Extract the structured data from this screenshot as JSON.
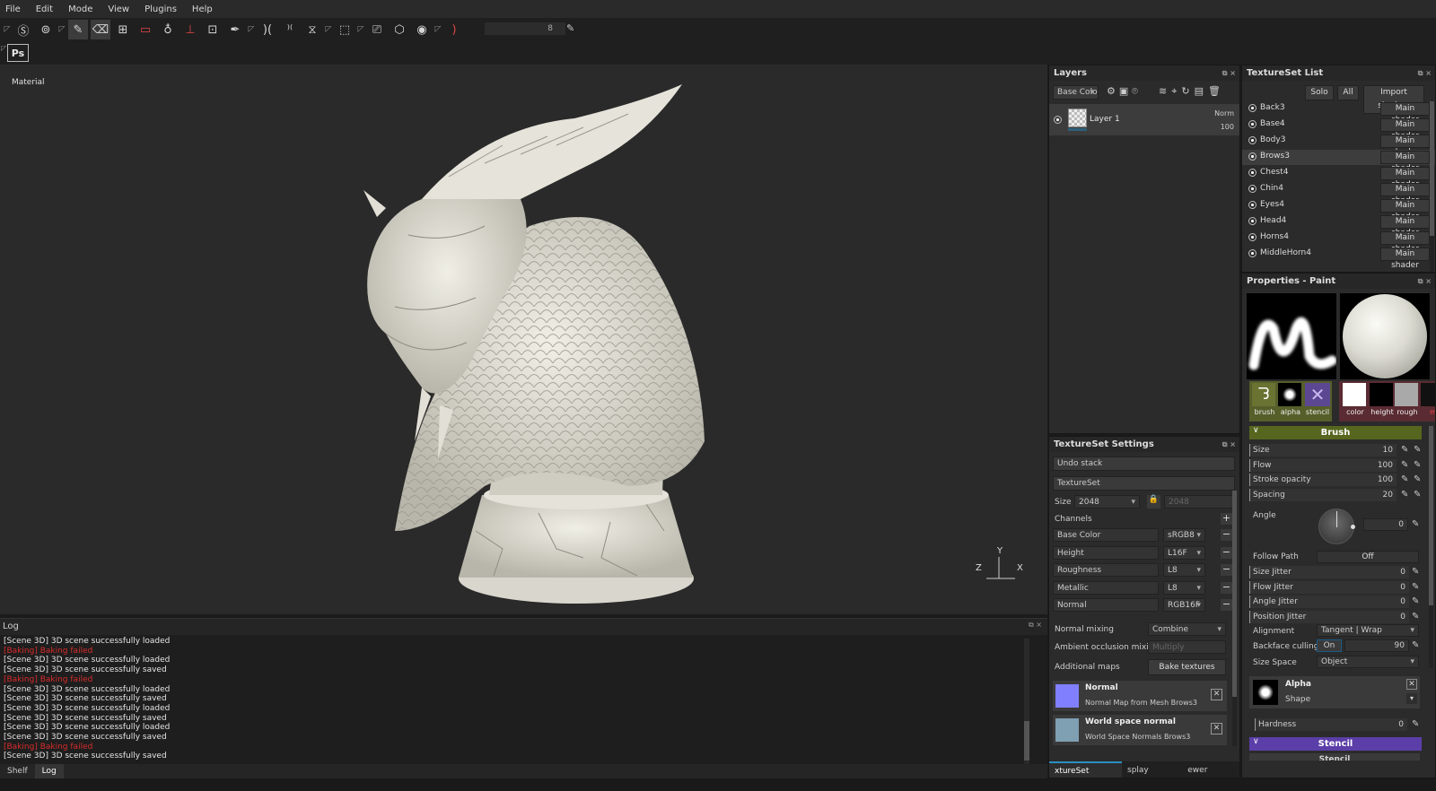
{
  "menu": [
    "File",
    "Edit",
    "Mode",
    "View",
    "Plugins",
    "Help"
  ],
  "toolbar": {
    "slider_value": "8",
    "ps_label": "Ps"
  },
  "viewport": {
    "label": "Material",
    "axis_y": "Y",
    "axis_z": "Z",
    "axis_x": "X"
  },
  "log": {
    "title": "Log",
    "lines": [
      {
        "t": "[Scene 3D] 3D scene successfully loaded",
        "err": false
      },
      {
        "t": "[Baking] Baking failed",
        "err": true
      },
      {
        "t": "[Scene 3D] 3D scene successfully loaded",
        "err": false
      },
      {
        "t": "[Scene 3D] 3D scene successfully saved",
        "err": false
      },
      {
        "t": "[Baking] Baking failed",
        "err": true
      },
      {
        "t": "[Scene 3D] 3D scene successfully loaded",
        "err": false
      },
      {
        "t": "[Scene 3D] 3D scene successfully saved",
        "err": false
      },
      {
        "t": "[Scene 3D] 3D scene successfully loaded",
        "err": false
      },
      {
        "t": "[Scene 3D] 3D scene successfully saved",
        "err": false
      },
      {
        "t": "[Scene 3D] 3D scene successfully loaded",
        "err": false
      },
      {
        "t": "[Scene 3D] 3D scene successfully saved",
        "err": false
      },
      {
        "t": "[Baking] Baking failed",
        "err": true
      },
      {
        "t": "[Scene 3D] 3D scene successfully saved",
        "err": false
      }
    ]
  },
  "bottom_tabs": {
    "shelf": "Shelf",
    "log": "Log"
  },
  "layers": {
    "title": "Layers",
    "channel": "Base Colo",
    "layer_name": "Layer 1",
    "blend": "Norm",
    "opacity": "100"
  },
  "textureset_list": {
    "title": "TextureSet List",
    "solo": "Solo",
    "all": "All",
    "import": "Import shaders",
    "shader": "Main shader",
    "items": [
      "Back3",
      "Base4",
      "Body3",
      "Brows3",
      "Chest4",
      "Chin4",
      "Eyes4",
      "Head4",
      "Horns4",
      "MiddleHorn4"
    ]
  },
  "ts_settings": {
    "title": "TextureSet Settings",
    "undo": "Undo stack",
    "textureset": "TextureSet",
    "size_label": "Size",
    "size": "2048",
    "size2": "2048",
    "channels_label": "Channels",
    "channels": [
      {
        "n": "Base Color",
        "f": "sRGB8"
      },
      {
        "n": "Height",
        "f": "L16F"
      },
      {
        "n": "Roughness",
        "f": "L8"
      },
      {
        "n": "Metallic",
        "f": "L8"
      },
      {
        "n": "Normal",
        "f": "RGB16F"
      }
    ],
    "normal_mixing_label": "Normal mixing",
    "normal_mixing": "Combine",
    "ao_mixing_label": "Ambient occlusion mixing",
    "ao_mixing": "Multiply",
    "additional_maps": "Additional maps",
    "bake": "Bake textures",
    "maps": [
      {
        "t": "Normal",
        "s": "Normal Map from Mesh Brows3"
      },
      {
        "t": "World space normal",
        "s": "World Space Normals Brows3"
      }
    ],
    "tabs": [
      "xtureSet Setting",
      "splay Setting",
      "ewer Setting"
    ]
  },
  "properties": {
    "title": "Properties - Paint",
    "slots": [
      "brush",
      "alpha",
      "stencil",
      "color",
      "height",
      "rough",
      "m"
    ],
    "brush_section": "Brush",
    "params": [
      {
        "n": "Size",
        "v": "10"
      },
      {
        "n": "Flow",
        "v": "100"
      },
      {
        "n": "Stroke opacity",
        "v": "100"
      },
      {
        "n": "Spacing",
        "v": "20"
      }
    ],
    "angle_label": "Angle",
    "angle_value": "0",
    "follow_path": "Follow Path",
    "follow_value": "Off",
    "jitters": [
      {
        "n": "Size Jitter",
        "v": "0"
      },
      {
        "n": "Flow Jitter",
        "v": "0"
      },
      {
        "n": "Angle Jitter",
        "v": "0"
      },
      {
        "n": "Position Jitter",
        "v": "0"
      }
    ],
    "alignment_label": "Alignment",
    "alignment": "Tangent | Wrap",
    "backface_label": "Backface culling",
    "backface_on": "On",
    "backface_value": "90",
    "size_space_label": "Size Space",
    "size_space": "Object",
    "alpha_title": "Alpha",
    "alpha_sub": "Shape",
    "hardness_label": "Hardness",
    "hardness": "0",
    "stencil_section": "Stencil",
    "stencil_cut": "Stencil"
  }
}
